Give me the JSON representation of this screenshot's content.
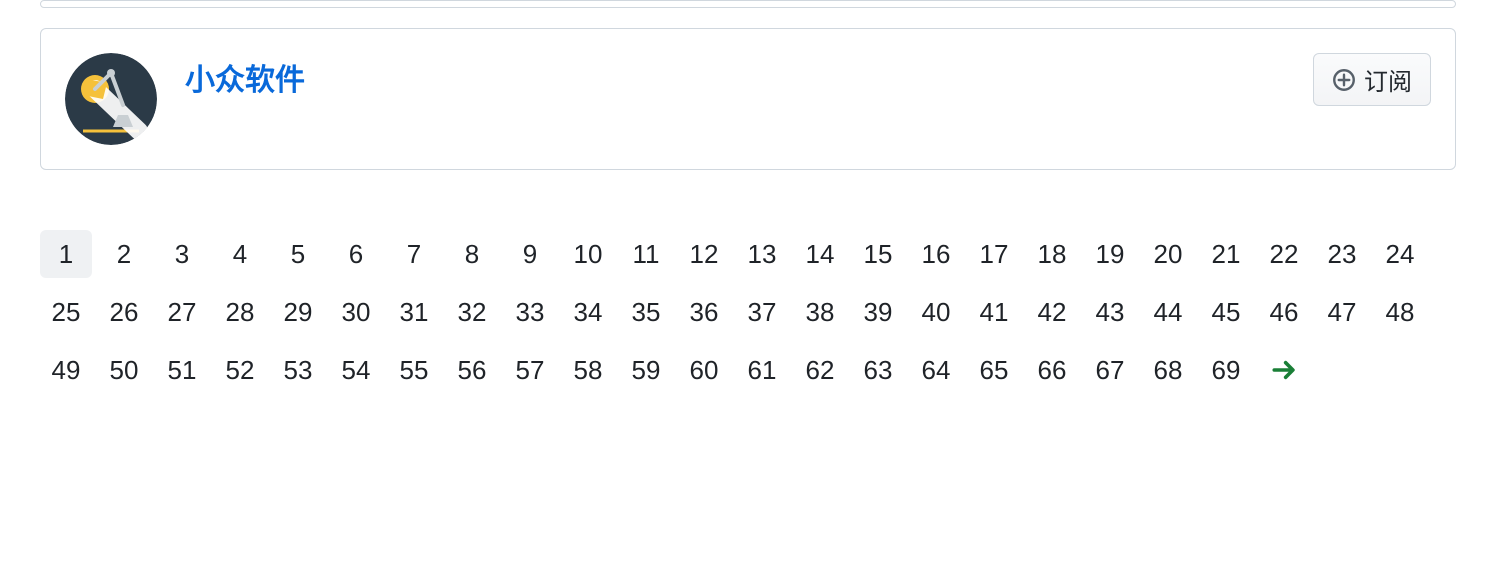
{
  "card": {
    "title": "小众软件",
    "subscribe_label": "订阅"
  },
  "pagination": {
    "current": 1,
    "pages": [
      1,
      2,
      3,
      4,
      5,
      6,
      7,
      8,
      9,
      10,
      11,
      12,
      13,
      14,
      15,
      16,
      17,
      18,
      19,
      20,
      21,
      22,
      23,
      24,
      25,
      26,
      27,
      28,
      29,
      30,
      31,
      32,
      33,
      34,
      35,
      36,
      37,
      38,
      39,
      40,
      41,
      42,
      43,
      44,
      45,
      46,
      47,
      48,
      49,
      50,
      51,
      52,
      53,
      54,
      55,
      56,
      57,
      58,
      59,
      60,
      61,
      62,
      63,
      64,
      65,
      66,
      67,
      68,
      69
    ]
  }
}
